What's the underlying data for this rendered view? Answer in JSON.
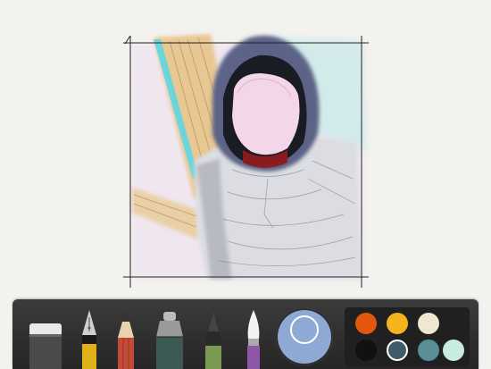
{
  "app": {
    "name": ""
  },
  "tools": [
    {
      "id": "eraser",
      "icon": "eraser-icon",
      "color": "#4a4a4a"
    },
    {
      "id": "fountain-pen",
      "icon": "fountain-pen-icon",
      "color": "#e0b21a"
    },
    {
      "id": "pencil",
      "icon": "pencil-icon",
      "color": "#c24a36"
    },
    {
      "id": "marker",
      "icon": "marker-icon",
      "color": "#3d5954"
    },
    {
      "id": "outline-pen",
      "icon": "outline-pen-icon",
      "color": "#7a9a54"
    },
    {
      "id": "brush",
      "icon": "brush-icon",
      "color": "#8e56a8"
    }
  ],
  "color_dial": {
    "icon": "color-mixer-icon",
    "color": "#8da9d4"
  },
  "palette": {
    "swatches": [
      {
        "color": "#e2560e",
        "selected": false
      },
      {
        "color": "#f5b41e",
        "selected": false
      },
      {
        "color": "#f1e6cf",
        "selected": false
      },
      {
        "color": "#111111",
        "selected": false
      },
      {
        "color": "#3f5b6a",
        "selected": true
      },
      {
        "color": "#5a8f95",
        "selected": false
      },
      {
        "color": "#c9ece0",
        "selected": false
      }
    ]
  },
  "colors": {
    "paper": "#f3f2ef",
    "toolbar": "#2f2f2f",
    "accent_blue": "#8da9d4"
  }
}
